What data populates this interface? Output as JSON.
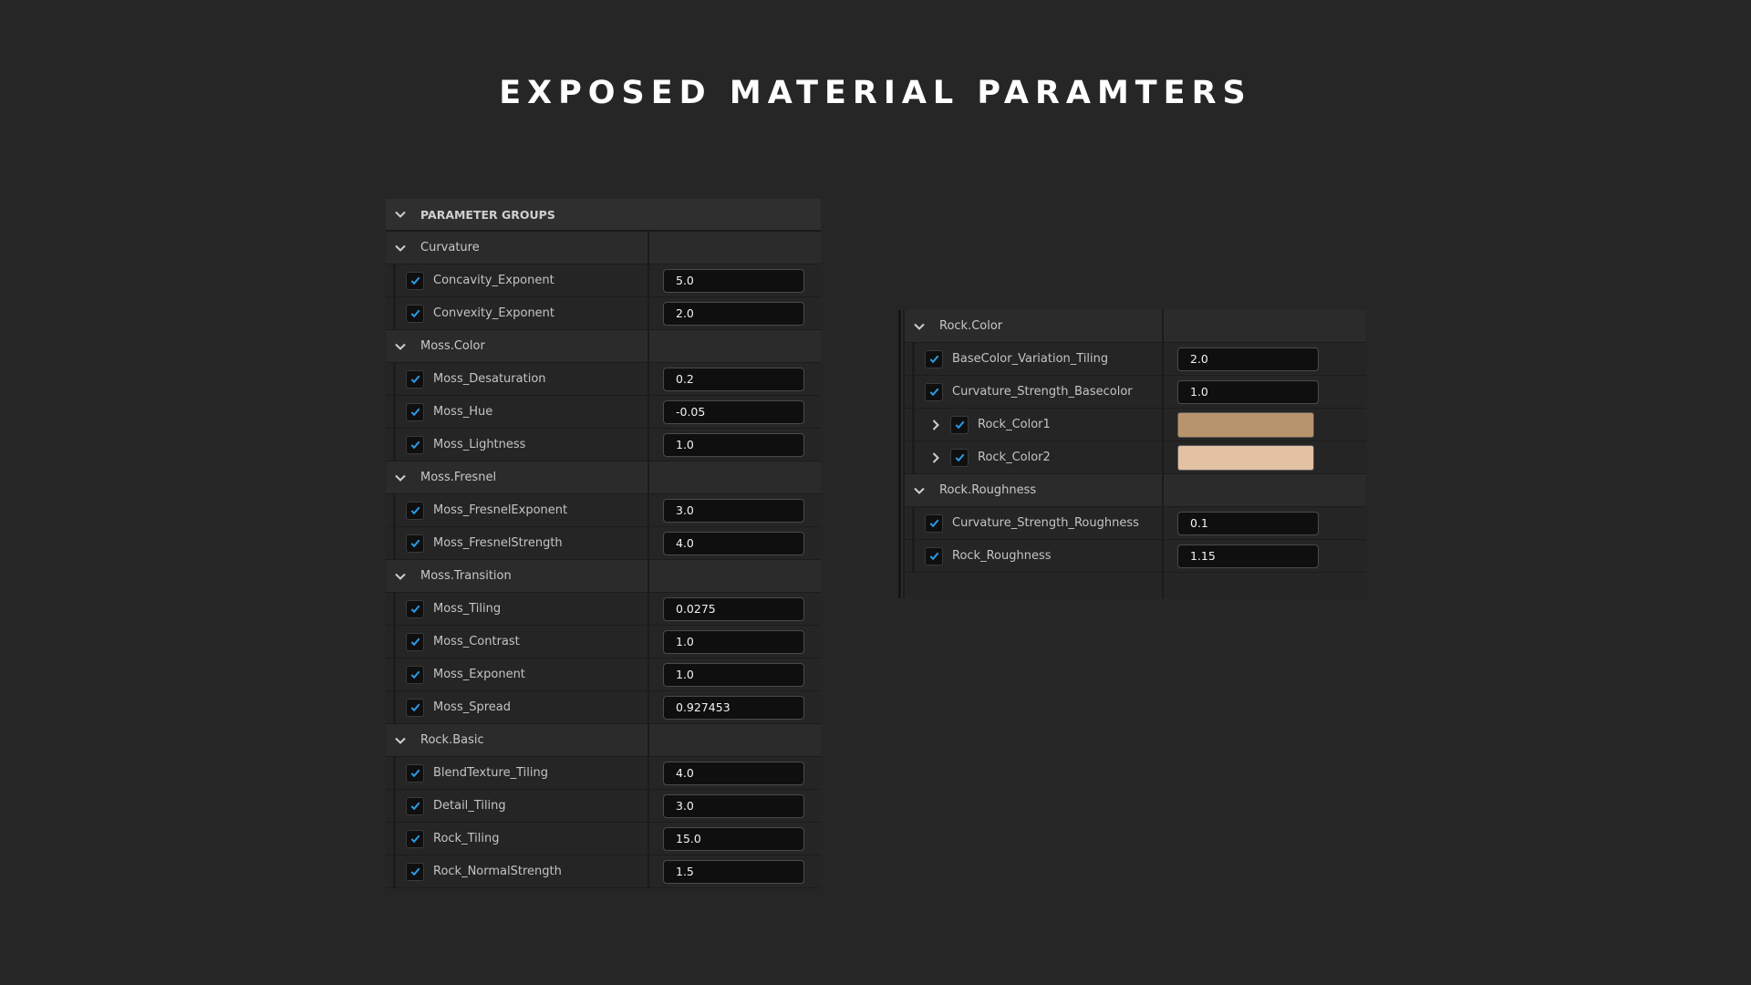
{
  "page": {
    "title": "EXPOSED MATERIAL PARAMTERS"
  },
  "colors": {
    "checkmark": "#2b9be3",
    "background": "#262626"
  },
  "left_panel": {
    "header": "PARAMETER GROUPS",
    "groups": [
      {
        "name": "Curvature",
        "params": [
          {
            "name": "Concavity_Exponent",
            "value": "5.0"
          },
          {
            "name": "Convexity_Exponent",
            "value": "2.0"
          }
        ]
      },
      {
        "name": "Moss.Color",
        "params": [
          {
            "name": "Moss_Desaturation",
            "value": "0.2"
          },
          {
            "name": "Moss_Hue",
            "value": "-0.05"
          },
          {
            "name": "Moss_Lightness",
            "value": "1.0"
          }
        ]
      },
      {
        "name": "Moss.Fresnel",
        "params": [
          {
            "name": "Moss_FresnelExponent",
            "value": "3.0"
          },
          {
            "name": "Moss_FresnelStrength",
            "value": "4.0"
          }
        ]
      },
      {
        "name": "Moss.Transition",
        "params": [
          {
            "name": "Moss_Tiling",
            "value": "0.0275"
          },
          {
            "name": "Moss_Contrast",
            "value": "1.0"
          },
          {
            "name": "Moss_Exponent",
            "value": "1.0"
          },
          {
            "name": "Moss_Spread",
            "value": "0.927453"
          }
        ]
      },
      {
        "name": "Rock.Basic",
        "params": [
          {
            "name": "BlendTexture_Tiling",
            "value": "4.0"
          },
          {
            "name": "Detail_Tiling",
            "value": "3.0"
          },
          {
            "name": "Rock_Tiling",
            "value": "15.0"
          },
          {
            "name": "Rock_NormalStrength",
            "value": "1.5"
          }
        ]
      }
    ]
  },
  "right_panel": {
    "groups": [
      {
        "name": "Rock.Color",
        "params": [
          {
            "name": "BaseColor_Variation_Tiling",
            "value": "2.0"
          },
          {
            "name": "Curvature_Strength_Basecolor",
            "value": "1.0"
          },
          {
            "name": "Rock_Color1",
            "color": "#b8946c",
            "expandable": true
          },
          {
            "name": "Rock_Color2",
            "color": "#e3c1a3",
            "expandable": true
          }
        ]
      },
      {
        "name": "Rock.Roughness",
        "params": [
          {
            "name": "Curvature_Strength_Roughness",
            "value": "0.1"
          },
          {
            "name": "Rock_Roughness",
            "value": "1.15"
          }
        ]
      }
    ]
  }
}
